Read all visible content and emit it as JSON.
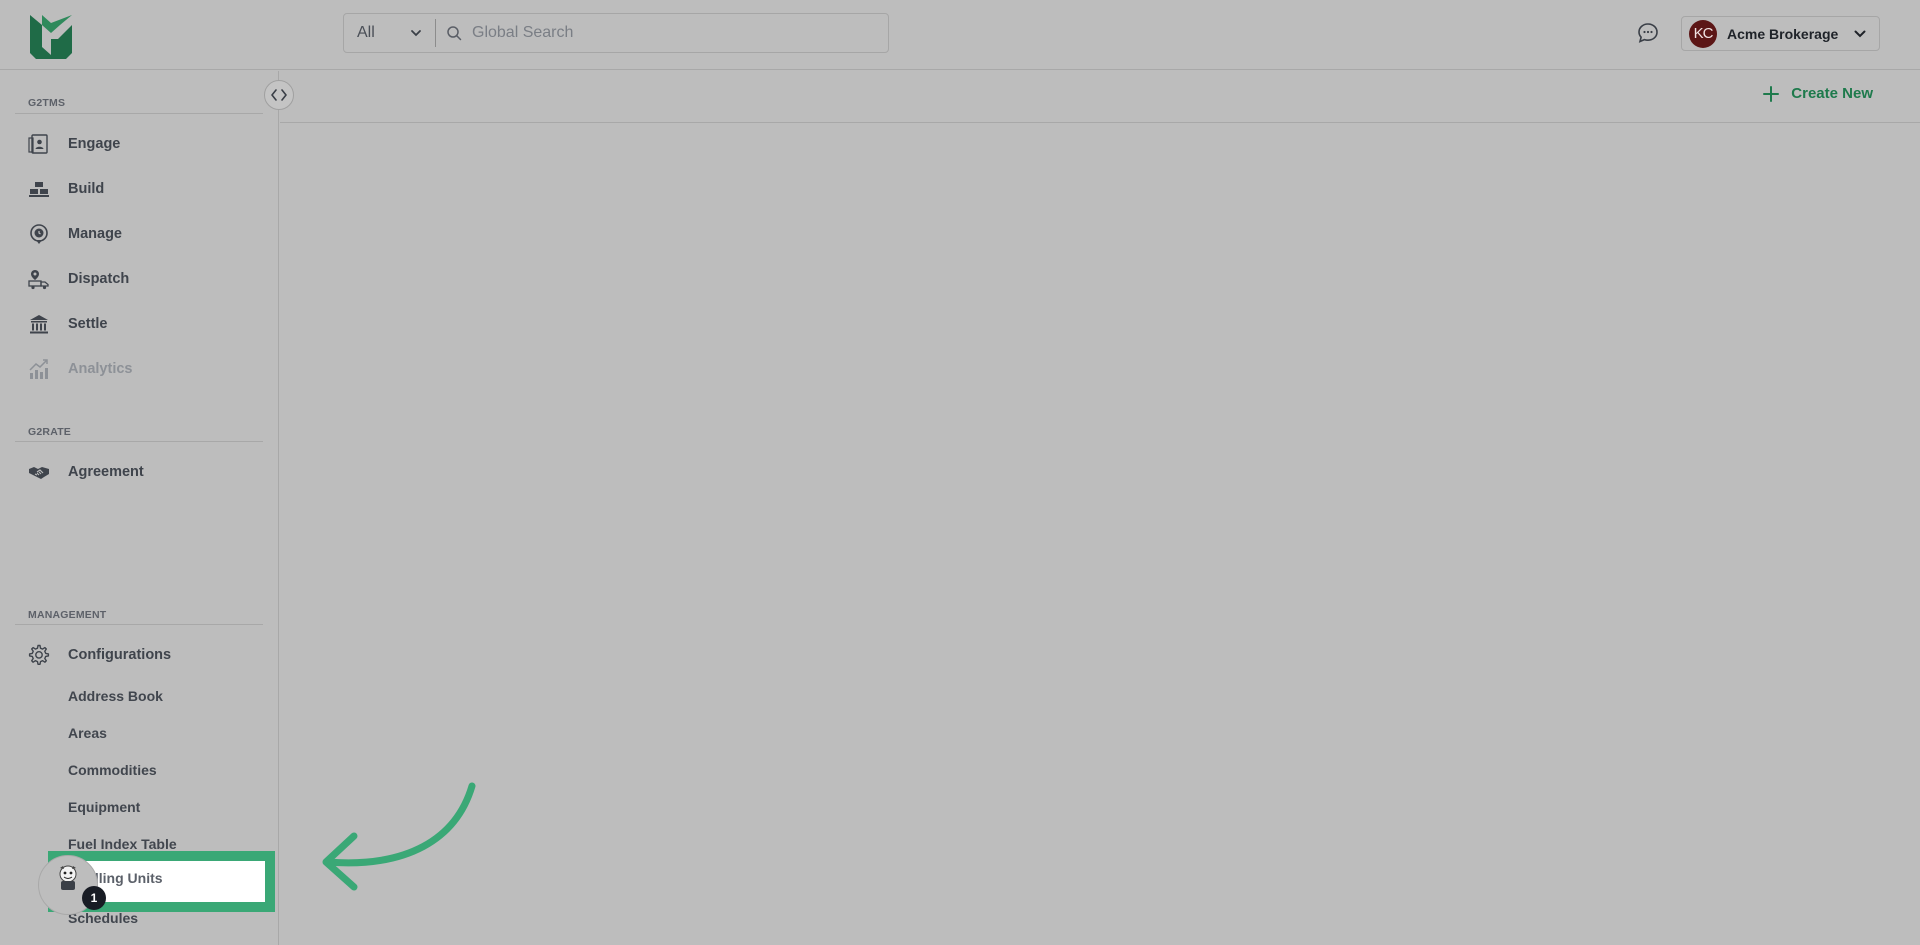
{
  "header": {
    "search": {
      "scope_value": "All",
      "placeholder": "Global Search"
    },
    "account": {
      "initials": "KC",
      "name": "Acme Brokerage"
    },
    "chat_icon": "chat-bubble-icon"
  },
  "sidebar": {
    "sections": [
      {
        "label": "G2TMS"
      },
      {
        "label": "G2RATE"
      },
      {
        "label": "MANAGEMENT"
      }
    ],
    "g2tms_items": [
      {
        "label": "Engage",
        "icon": "engage-icon"
      },
      {
        "label": "Build",
        "icon": "build-icon"
      },
      {
        "label": "Manage",
        "icon": "manage-icon"
      },
      {
        "label": "Dispatch",
        "icon": "dispatch-icon"
      },
      {
        "label": "Settle",
        "icon": "settle-icon"
      },
      {
        "label": "Analytics",
        "icon": "analytics-icon"
      }
    ],
    "g2rate_items": [
      {
        "label": "Agreement",
        "icon": "handshake-icon"
      }
    ],
    "management_items": [
      {
        "label": "Configurations",
        "icon": "gear-icon"
      }
    ],
    "config_sub_items": [
      {
        "label": "Address Book"
      },
      {
        "label": "Areas"
      },
      {
        "label": "Commodities"
      },
      {
        "label": "Equipment"
      },
      {
        "label": "Fuel Index Table"
      },
      {
        "label": "Billing Units"
      },
      {
        "label": "Schedules"
      }
    ],
    "highlighted_item_visible_text": "illing Units",
    "step_number": "1"
  },
  "main": {
    "create_new_label": "Create New"
  },
  "colors": {
    "brand_green": "#1e7a4c",
    "highlight_green": "#3aa876",
    "avatar_bg": "#5c1616",
    "overlay_gray": "#bdbdbd"
  }
}
